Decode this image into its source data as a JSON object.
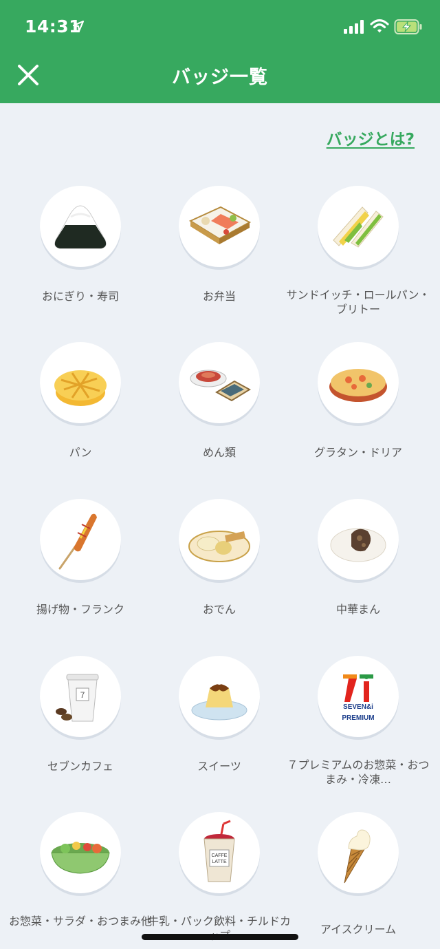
{
  "status_bar": {
    "time": "14:31"
  },
  "header": {
    "title": "バッジ一覧",
    "close_icon": "close-icon"
  },
  "help_link": "バッジとは?",
  "colors": {
    "header_bg": "#37a95f",
    "page_bg": "#edf1f6",
    "label_text": "#555555"
  },
  "badges": [
    {
      "label": "おにぎり・寿司",
      "icon": "onigiri-icon"
    },
    {
      "label": "お弁当",
      "icon": "bento-icon"
    },
    {
      "label": "サンドイッチ・ロールパン・ブリトー",
      "icon": "sandwich-icon"
    },
    {
      "label": "パン",
      "icon": "bread-icon"
    },
    {
      "label": "めん類",
      "icon": "noodles-icon"
    },
    {
      "label": "グラタン・ドリア",
      "icon": "gratin-icon"
    },
    {
      "label": "揚げ物・フランク",
      "icon": "corndog-icon"
    },
    {
      "label": "おでん",
      "icon": "oden-icon"
    },
    {
      "label": "中華まん",
      "icon": "steamed-bun-icon"
    },
    {
      "label": "セブンカフェ",
      "icon": "coffee-cup-icon"
    },
    {
      "label": "スイーツ",
      "icon": "pudding-icon"
    },
    {
      "label": "７プレミアムのお惣菜・おつまみ・冷凍…",
      "icon": "seven-premium-logo"
    },
    {
      "label": "お惣菜・サラダ・おつまみ他",
      "icon": "salad-icon"
    },
    {
      "label": "牛乳・パック飲料・チルドカップ",
      "icon": "chilled-cup-icon"
    },
    {
      "label": "アイスクリーム",
      "icon": "ice-cream-icon"
    }
  ],
  "logo_text": {
    "seven_and_i": "SEVEN&i",
    "premium": "PREMIUM",
    "caffe": "CAFFE",
    "latte": "LATTE"
  }
}
